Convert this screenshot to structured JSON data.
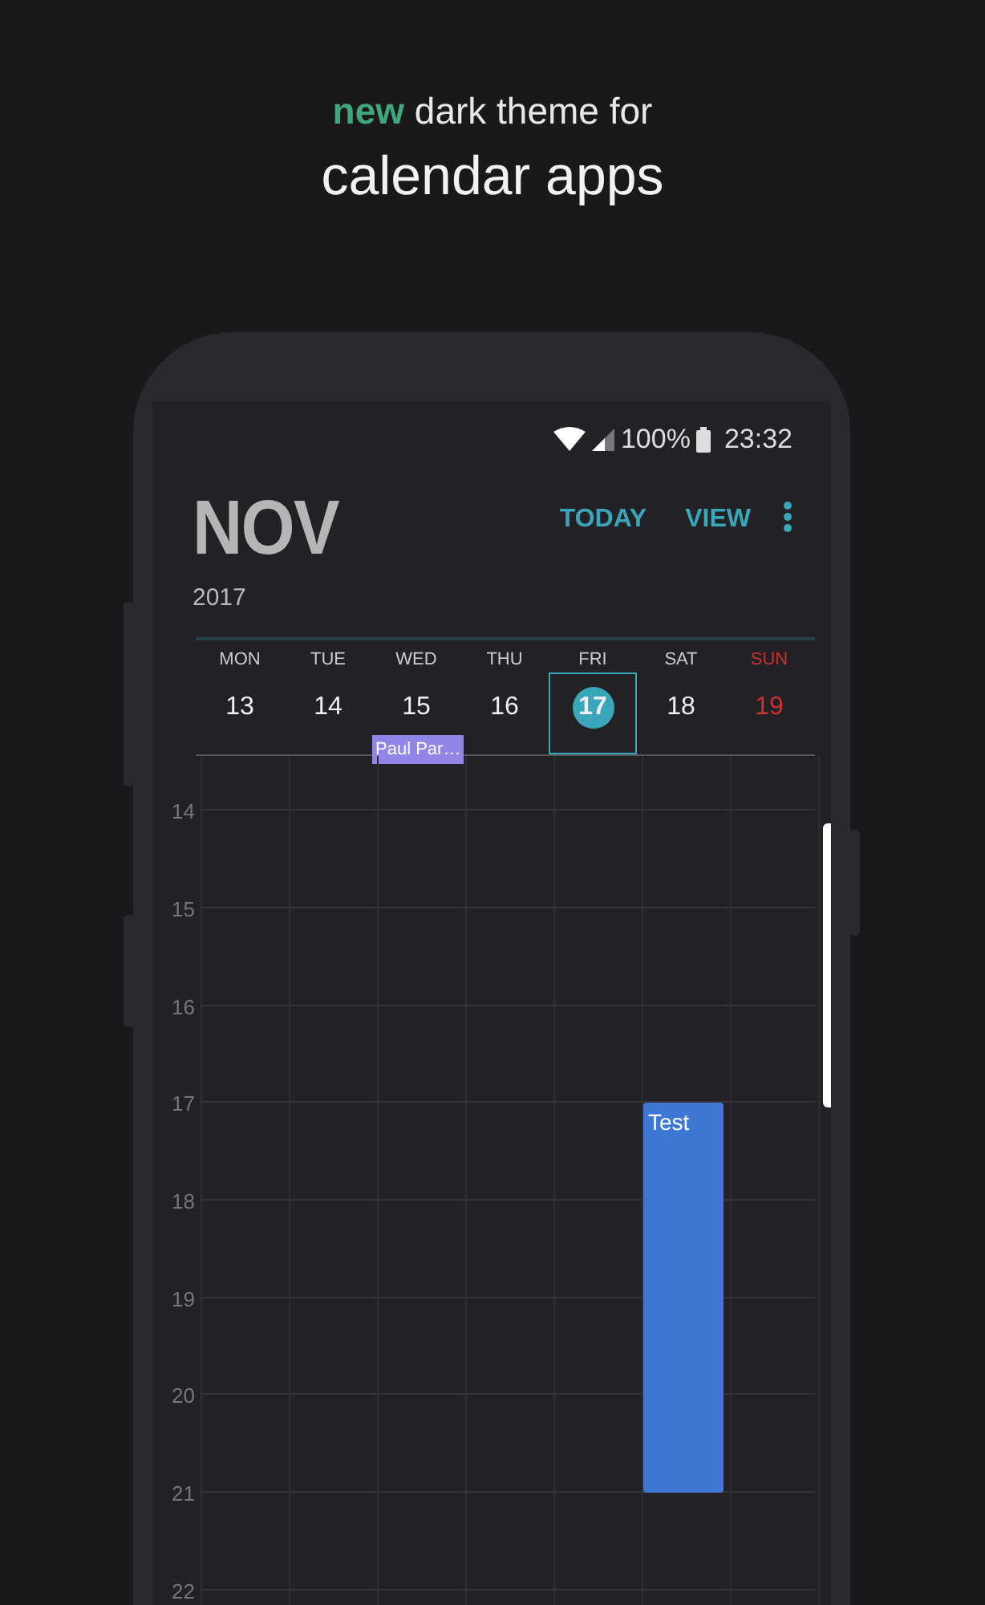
{
  "headline": "**new** dark theme for",
  "title": "calendar apps",
  "status_bar": {
    "battery": "100%",
    "time": "23:32"
  },
  "header": {
    "month": "NOV",
    "year": "2017",
    "actions": [
      "TODAY",
      "VIEW"
    ]
  },
  "days": [
    {
      "name": "MON",
      "date": "13",
      "selected": false,
      "kind": "weekday"
    },
    {
      "name": "TUE",
      "date": "14",
      "selected": false,
      "kind": "weekday"
    },
    {
      "name": "WED",
      "date": "15",
      "selected": false,
      "kind": "weekday",
      "all_day": [
        {
          "title": "Paul Par…",
          "color": "#8f86e8"
        }
      ]
    },
    {
      "name": "THU",
      "date": "16",
      "selected": false,
      "kind": "weekday"
    },
    {
      "name": "FRI",
      "date": "17",
      "selected": true,
      "kind": "weekday"
    },
    {
      "name": "SAT",
      "date": "18",
      "selected": false,
      "kind": "weekday",
      "timed": [
        {
          "title": "Test",
          "color": "#3f78d4"
        }
      ]
    },
    {
      "name": "SUN",
      "date": "19",
      "selected": false,
      "kind": "sunday"
    }
  ],
  "hours": [
    {
      "label": "14",
      "event_covers": false
    },
    {
      "label": "15",
      "event_covers": false
    },
    {
      "label": "16",
      "event_covers": false
    },
    {
      "label": "17",
      "event_covers": true
    },
    {
      "label": "18",
      "event_covers": true
    },
    {
      "label": "19",
      "event_covers": true
    },
    {
      "label": "20",
      "event_covers": true
    },
    {
      "label": "21",
      "event_covers": false
    },
    {
      "label": "22",
      "event_covers": false
    }
  ]
}
